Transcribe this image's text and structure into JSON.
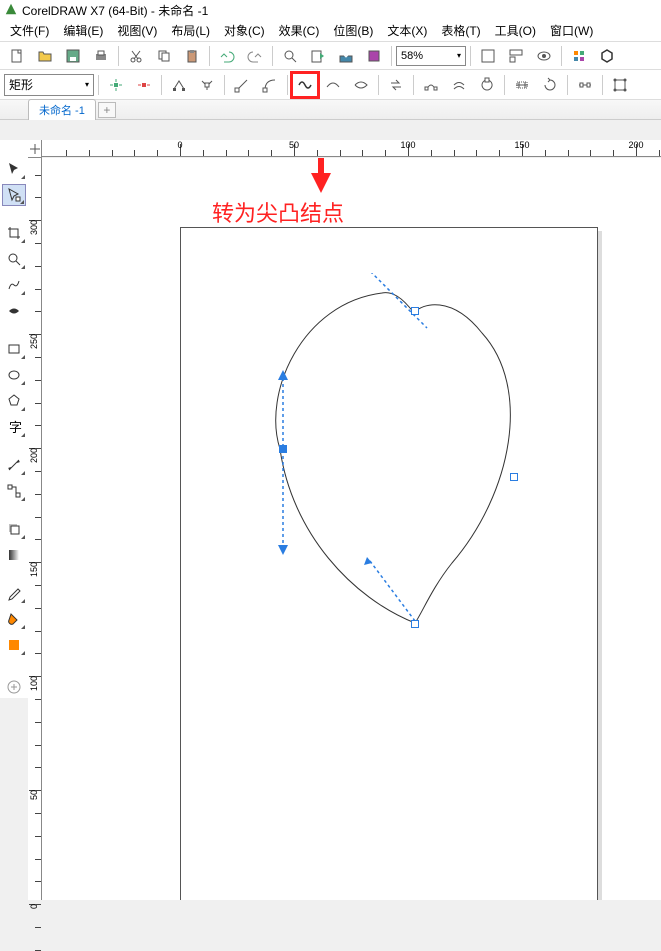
{
  "title": "CorelDRAW X7 (64-Bit) - 未命名 -1",
  "menu": [
    "文件(F)",
    "编辑(E)",
    "视图(V)",
    "布局(L)",
    "对象(C)",
    "效果(C)",
    "位图(B)",
    "文本(X)",
    "表格(T)",
    "工具(O)",
    "窗口(W)"
  ],
  "zoom": "58%",
  "shape_select": "矩形",
  "tab_name": "未命名 -1",
  "annotation": "转为尖凸结点",
  "ruler_h": [
    0,
    50,
    100,
    150,
    200
  ],
  "ruler_v": [
    300,
    250,
    200,
    150,
    100,
    50,
    0
  ]
}
